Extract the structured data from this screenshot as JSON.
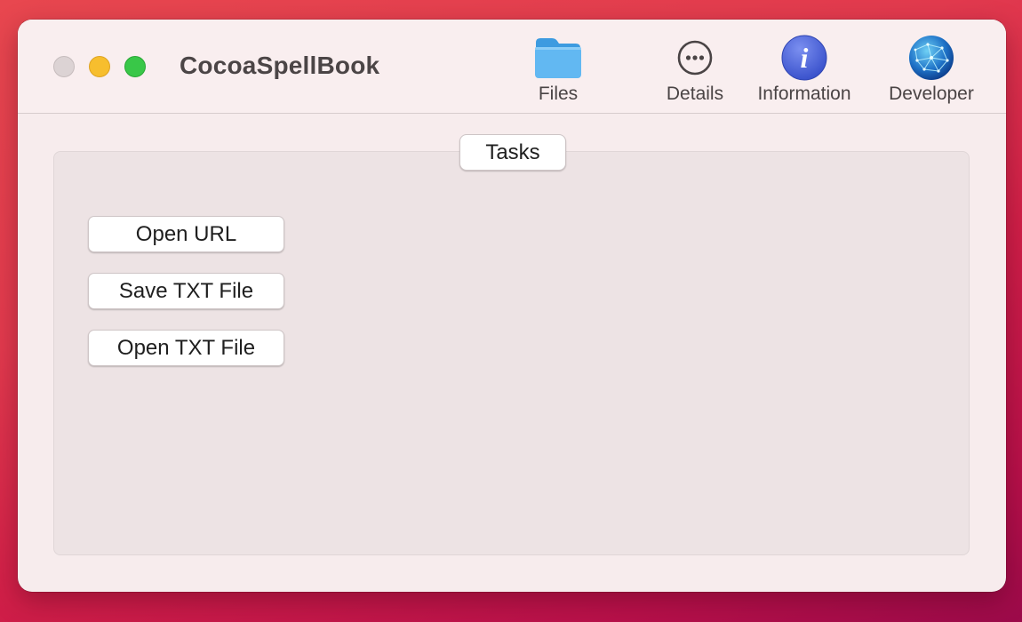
{
  "window": {
    "title": "CocoaSpellBook"
  },
  "toolbar": {
    "items": [
      {
        "label": "Files",
        "icon": "folder-icon"
      },
      {
        "label": "Details",
        "icon": "ellipsis-circle-icon"
      },
      {
        "label": "Information",
        "icon": "info-icon"
      },
      {
        "label": "Developer",
        "icon": "globe-network-icon"
      }
    ]
  },
  "tasks": {
    "title": "Tasks",
    "buttons": [
      {
        "label": "Open URL"
      },
      {
        "label": "Save TXT File"
      },
      {
        "label": "Open TXT File"
      }
    ]
  },
  "colors": {
    "close": "#dcd3d4",
    "minimize": "#f7be2e",
    "maximize": "#39c748",
    "folder": "#5ab2ee",
    "info": "#4a63d8"
  }
}
